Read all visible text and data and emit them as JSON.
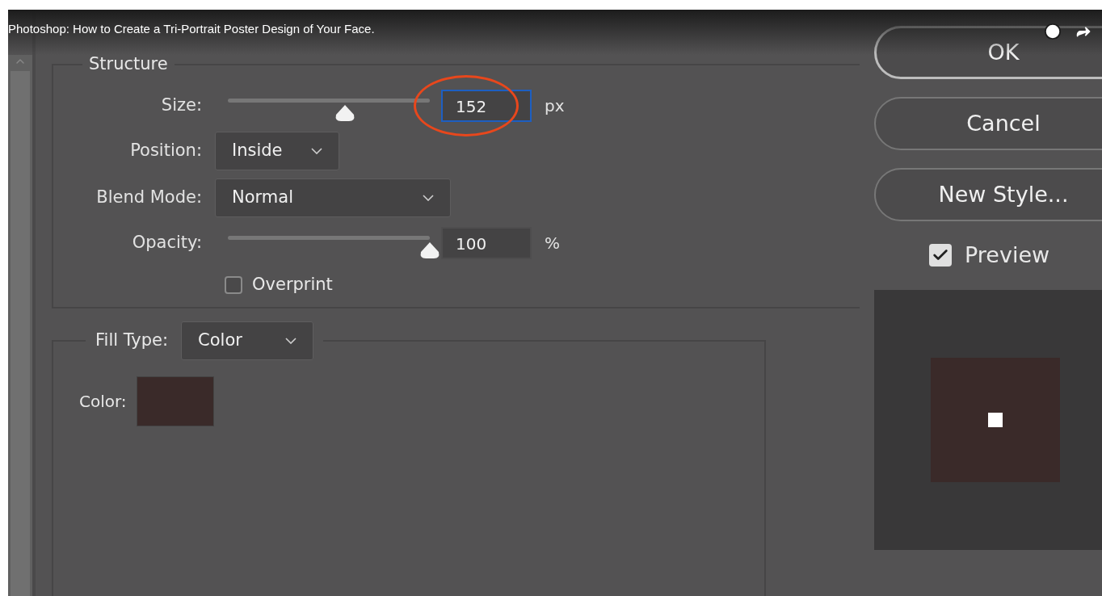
{
  "video_title": "Photoshop: How to Create a Tri-Portrait Poster Design of Your Face.",
  "structure": {
    "legend": "Structure",
    "size": {
      "label": "Size:",
      "level": 0.58,
      "value": "152",
      "unit": "px",
      "focused": true,
      "circled": true
    },
    "position": {
      "label": "Position:",
      "value": "Inside"
    },
    "blend_mode": {
      "label": "Blend Mode:",
      "value": "Normal"
    },
    "opacity": {
      "label": "Opacity:",
      "level": 1,
      "value": "100",
      "unit": "%",
      "focused": false,
      "circled": false
    },
    "overprint": {
      "label": "Overprint",
      "checked": false
    }
  },
  "fill": {
    "label": "Fill Type:",
    "value": "Color",
    "color_label": "Color:",
    "color": "#3a2a29"
  },
  "buttons": [
    {
      "label": "OK",
      "kind": "default"
    },
    {
      "label": "Cancel",
      "kind": "normal"
    },
    {
      "label": "New Style...",
      "kind": "normal"
    }
  ],
  "preview": {
    "label": "Preview",
    "checked": true
  }
}
